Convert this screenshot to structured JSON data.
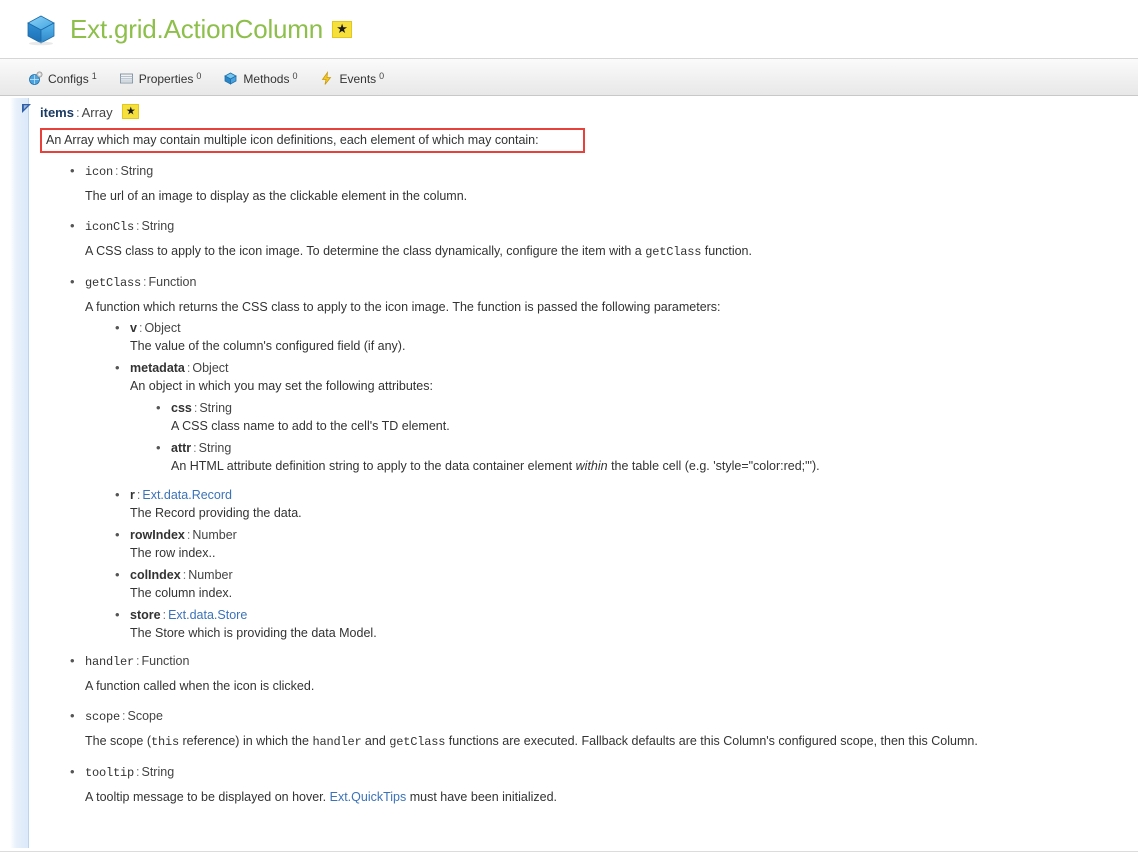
{
  "header": {
    "title": "Ext.grid.ActionColumn",
    "icon": "cube-icon",
    "badge": "star-badge",
    "badge_glyph": "★",
    "title_color": "#8DBF4A"
  },
  "tabs": [
    {
      "label": "Configs",
      "count": "1",
      "icon": "configs-icon"
    },
    {
      "label": "Properties",
      "count": "0",
      "icon": "properties-icon"
    },
    {
      "label": "Methods",
      "count": "0",
      "icon": "methods-icon"
    },
    {
      "label": "Events",
      "count": "0",
      "icon": "events-icon"
    }
  ],
  "member": {
    "name": "items",
    "colon": ":",
    "type": "Array",
    "badge_glyph": "★",
    "highlight": {
      "text": "An Array which may contain multiple icon definitions, each element of which may contain:",
      "border_color": "#E8403A"
    }
  },
  "entries": {
    "icon": {
      "name": "icon",
      "sep": ":",
      "type": "String",
      "desc": "The url of an image to display as the clickable element in the column."
    },
    "iconCls": {
      "name": "iconCls",
      "sep": ":",
      "type": "String",
      "desc_a": "A CSS class to apply to the icon image. To determine the class dynamically, configure the item with a ",
      "desc_code": "getClass",
      "desc_b": " function."
    },
    "getClass": {
      "name": "getClass",
      "sep": ":",
      "type": "Function",
      "desc": "A function which returns the CSS class to apply to the icon image. The function is passed the following parameters:",
      "params": {
        "v": {
          "name": "v",
          "sep": ":",
          "type": "Object",
          "desc": "The value of the column's configured field (if any)."
        },
        "metadata": {
          "name": "metadata",
          "sep": ":",
          "type": "Object",
          "desc": "An object in which you may set the following attributes:",
          "attrs": {
            "css": {
              "name": "css",
              "sep": ":",
              "type": "String",
              "desc": "A CSS class name to add to the cell's TD element."
            },
            "attr": {
              "name": "attr",
              "sep": ":",
              "type": "String",
              "desc_a": "An HTML attribute definition string to apply to the data container element ",
              "desc_em": "within",
              "desc_b": " the table cell (e.g. 'style=\"color:red;\"')."
            }
          }
        },
        "r": {
          "name": "r",
          "sep": ":",
          "type": "Ext.data.Record",
          "type_is_link": true,
          "desc": "The Record providing the data."
        },
        "rowIndex": {
          "name": "rowIndex",
          "sep": ":",
          "type": "Number",
          "desc": "The row index.."
        },
        "colIndex": {
          "name": "colIndex",
          "sep": ":",
          "type": "Number",
          "desc": "The column index."
        },
        "store": {
          "name": "store",
          "sep": ":",
          "type": "Ext.data.Store",
          "type_is_link": true,
          "desc": "The Store which is providing the data Model."
        }
      }
    },
    "handler": {
      "name": "handler",
      "sep": ":",
      "type": "Function",
      "desc": "A function called when the icon is clicked."
    },
    "scope": {
      "name": "scope",
      "sep": ":",
      "type": "Scope",
      "desc_a": "The scope (",
      "desc_code1": "this",
      "desc_b": " reference) in which the ",
      "desc_code2": "handler",
      "desc_c": " and ",
      "desc_code3": "getClass",
      "desc_d": " functions are executed. Fallback defaults are this Column's configured scope, then this Column."
    },
    "tooltip": {
      "name": "tooltip",
      "sep": ":",
      "type": "String",
      "desc_a": "A tooltip message to be displayed on hover. ",
      "desc_link": "Ext.QuickTips",
      "desc_b": " must have been initialized."
    }
  }
}
